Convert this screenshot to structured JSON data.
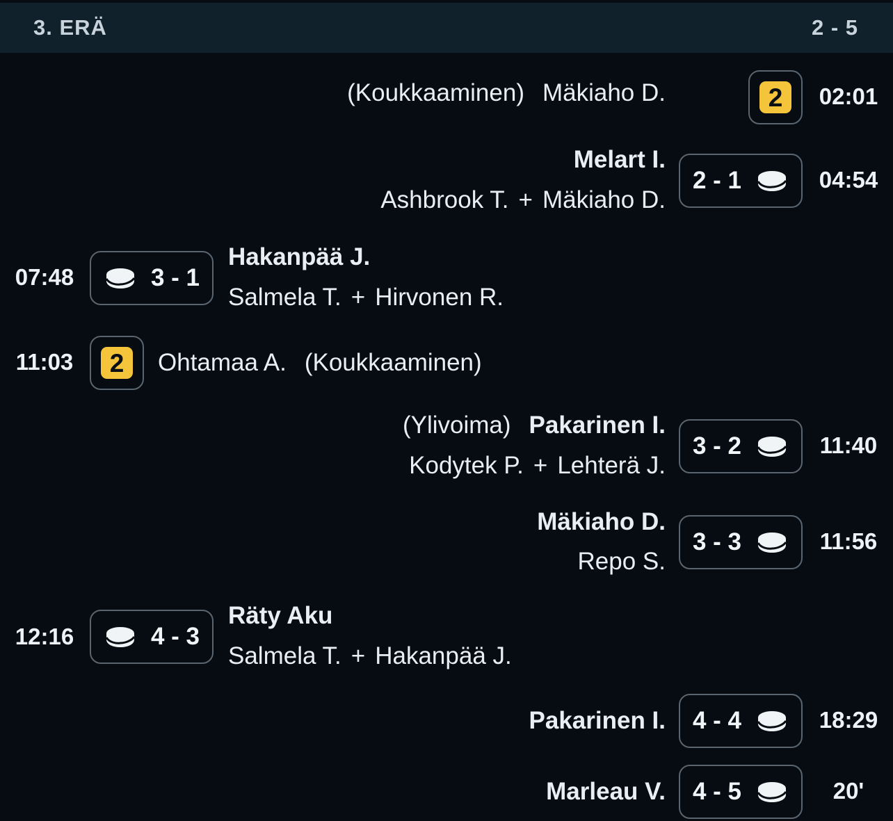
{
  "header": {
    "period": "3. ERÄ",
    "score": "2 - 5"
  },
  "events": [
    {
      "type": "penalty",
      "side": "right",
      "time": "02:01",
      "minutes": "2",
      "player": "Mäkiaho D.",
      "reason": "(Koukkaaminen)"
    },
    {
      "type": "goal",
      "side": "right",
      "time": "04:54",
      "score": "2 - 1",
      "scorer": "Melart I.",
      "assist1": "Ashbrook T.",
      "assist2": "Mäkiaho D."
    },
    {
      "type": "goal",
      "side": "left",
      "time": "07:48",
      "score": "3 - 1",
      "scorer": "Hakanpää J.",
      "assist1": "Salmela T.",
      "assist2": "Hirvonen R."
    },
    {
      "type": "penalty",
      "side": "left",
      "time": "11:03",
      "minutes": "2",
      "player": "Ohtamaa A.",
      "reason": "(Koukkaaminen)"
    },
    {
      "type": "goal",
      "side": "right",
      "time": "11:40",
      "score": "3 - 2",
      "scorer": "Pakarinen I.",
      "tag": "(Ylivoima)",
      "assist1": "Kodytek P.",
      "assist2": "Lehterä J."
    },
    {
      "type": "goal",
      "side": "right",
      "time": "11:56",
      "score": "3 - 3",
      "scorer": "Mäkiaho D.",
      "assist1": "Repo S."
    },
    {
      "type": "goal",
      "side": "left",
      "time": "12:16",
      "score": "4 - 3",
      "scorer": "Räty Aku",
      "assist1": "Salmela T.",
      "assist2": "Hakanpää J."
    },
    {
      "type": "goal",
      "side": "right",
      "time": "18:29",
      "score": "4 - 4",
      "scorer": "Pakarinen I."
    },
    {
      "type": "goal",
      "side": "right",
      "time": "20'",
      "score": "4 - 5",
      "scorer": "Marleau V."
    }
  ],
  "icons": {
    "goal": "hockey-puck-icon",
    "penalty": "penalty-badge-icon"
  },
  "colors": {
    "background": "#060c12",
    "header": "#10212c",
    "penalty_badge": "#f4c43a",
    "box_border": "#5a6570"
  }
}
